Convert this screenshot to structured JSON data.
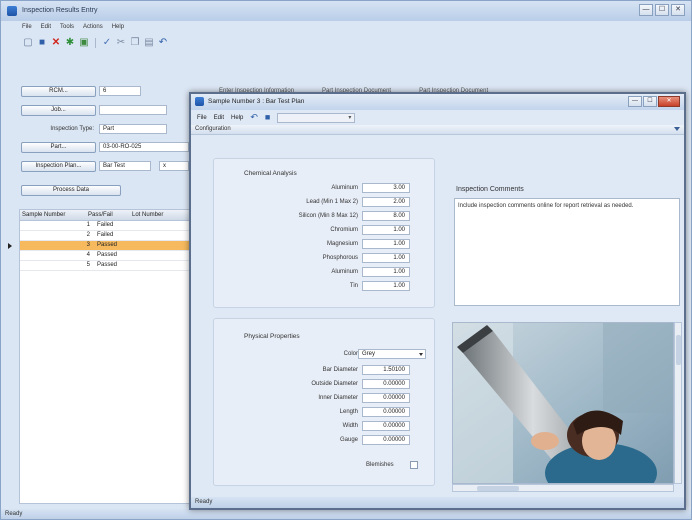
{
  "main": {
    "title": "Inspection Results Entry",
    "window_buttons": [
      "—",
      "☐",
      "✕"
    ],
    "menu": [
      "File",
      "Edit",
      "Tools",
      "Actions",
      "Help"
    ],
    "toolbar_icons": [
      "new-icon",
      "save-icon",
      "delete-icon",
      "refresh-icon",
      "print-icon",
      "check-icon",
      "cut-icon",
      "copy-icon",
      "paste-icon",
      "undo-icon"
    ],
    "form": {
      "rcm_button": "RCM...",
      "rcm_value": "6",
      "job_button": "Job...",
      "job_value": "",
      "inspection_type_label": "Inspection Type:",
      "inspection_type_value": "Part",
      "part_button": "Part...",
      "part_value": "03-00-RO-025",
      "inspection_plan_button": "Inspection Plan...",
      "inspection_plan_value": "Bar Test",
      "inspection_plan_extra": "x",
      "process_button": "Process Data"
    },
    "entry_tabs": [
      "Enter Inspection Information",
      "Part Inspection Document",
      "Part Inspection Document"
    ],
    "grid": {
      "headers": [
        "Sample Number",
        "Pass/Fail",
        "Lot Number"
      ],
      "rows": [
        {
          "num": "1",
          "status": "Failed"
        },
        {
          "num": "2",
          "status": "Failed"
        },
        {
          "num": "3",
          "status": "Passed"
        },
        {
          "num": "4",
          "status": "Passed"
        },
        {
          "num": "5",
          "status": "Passed"
        }
      ],
      "selected_index": 2
    },
    "status": "Ready"
  },
  "dialog": {
    "title": "Sample Number 3 : Bar Test Plan",
    "menu": [
      "File",
      "Edit",
      "Help"
    ],
    "toolbar_icons": [
      "back-icon",
      "save-icon"
    ],
    "combo_value": "",
    "config_label": "Configuration",
    "chemical": {
      "title": "Chemical Analysis",
      "rows": [
        {
          "label": "Aluminum",
          "value": "3.00"
        },
        {
          "label": "Lead (Min 1 Max 2)",
          "value": "2.00"
        },
        {
          "label": "Silicon (Min 8 Max 12)",
          "value": "8.00"
        },
        {
          "label": "Chromium",
          "value": "1.00"
        },
        {
          "label": "Magnesium",
          "value": "1.00"
        },
        {
          "label": "Phosphorous",
          "value": "1.00"
        },
        {
          "label": "Aluminum",
          "value": "1.00"
        },
        {
          "label": "Tin",
          "value": "1.00"
        }
      ]
    },
    "comments": {
      "title": "Inspection Comments",
      "text": "Include inspection comments online for report retrieval as needed."
    },
    "physical": {
      "title": "Physical Properties",
      "color_label": "Color",
      "color_value": "Grey",
      "rows": [
        {
          "label": "Bar Diameter",
          "value": "1.50100"
        },
        {
          "label": "Outside Diameter",
          "value": "0.00000"
        },
        {
          "label": "Inner Diameter",
          "value": "0.00000"
        },
        {
          "label": "Length",
          "value": "0.00000"
        },
        {
          "label": "Width",
          "value": "0.00000"
        },
        {
          "label": "Gauge",
          "value": "0.00000"
        }
      ],
      "blemishes_label": "Blemishes"
    },
    "status": "Ready"
  }
}
